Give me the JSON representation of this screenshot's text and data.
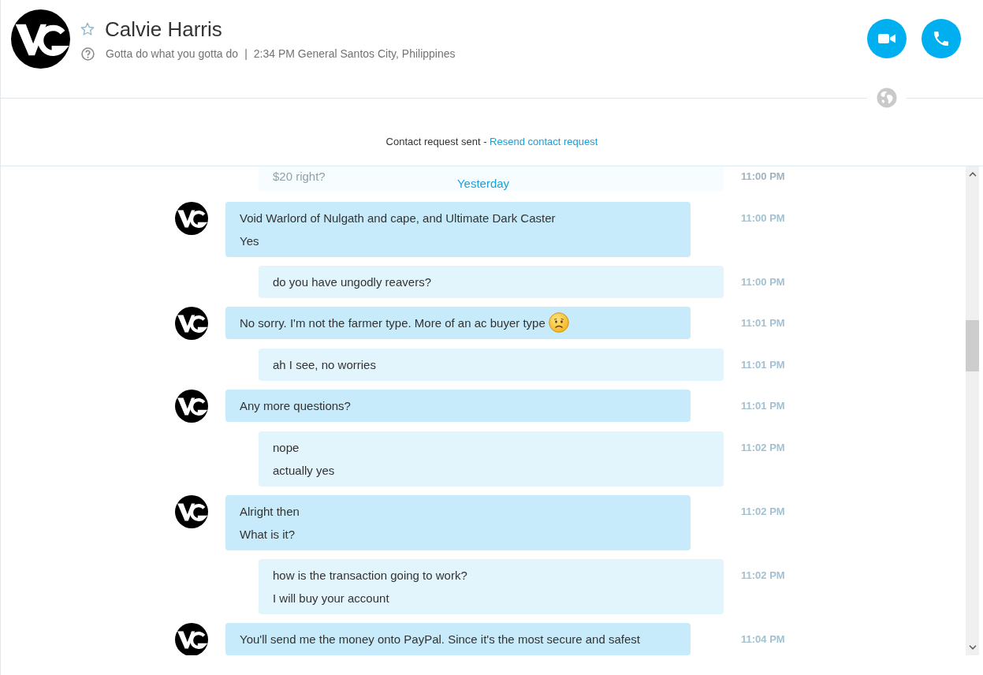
{
  "contact": {
    "name": "Calvie Harris",
    "favorite": false,
    "mood": "Gotta do what you gotta do",
    "separator": "|",
    "local_time": "2:34 PM General Santos City, Philippines"
  },
  "notice": {
    "text": "Contact request sent -",
    "link": "Resend contact request"
  },
  "date_divider": "Yesterday",
  "messages": [
    {
      "kind": "outgoing",
      "faded": true,
      "emoji": false,
      "lines": [
        "$20 right?"
      ],
      "time": "11:00 PM"
    },
    {
      "kind": "incoming",
      "faded": false,
      "emoji": false,
      "lines": [
        "Void Warlord of Nulgath and cape, and Ultimate Dark Caster",
        "Yes"
      ],
      "time": "11:00 PM"
    },
    {
      "kind": "outgoing",
      "faded": false,
      "emoji": false,
      "lines": [
        "do you have ungodly reavers?"
      ],
      "time": "11:00 PM"
    },
    {
      "kind": "incoming",
      "faded": false,
      "emoji": true,
      "lines": [
        "No sorry. I'm not the farmer type. More of an ac buyer type"
      ],
      "time": "11:01 PM"
    },
    {
      "kind": "outgoing",
      "faded": false,
      "emoji": false,
      "lines": [
        "ah I see, no worries"
      ],
      "time": "11:01 PM"
    },
    {
      "kind": "incoming",
      "faded": false,
      "emoji": false,
      "lines": [
        "Any more questions?"
      ],
      "time": "11:01 PM"
    },
    {
      "kind": "outgoing",
      "faded": false,
      "emoji": false,
      "lines": [
        "nope",
        "actually yes"
      ],
      "time": "11:02 PM"
    },
    {
      "kind": "incoming",
      "faded": false,
      "emoji": false,
      "lines": [
        "Alright then",
        "What is it?"
      ],
      "time": "11:02 PM"
    },
    {
      "kind": "outgoing",
      "faded": false,
      "emoji": false,
      "lines": [
        "how is the transaction going to work?",
        "I will buy your account"
      ],
      "time": "11:02 PM"
    },
    {
      "kind": "incoming",
      "faded": false,
      "emoji": false,
      "lines": [
        "You'll send me the money onto PayPal. Since it's the most secure and safest"
      ],
      "time": "11:04 PM"
    }
  ]
}
